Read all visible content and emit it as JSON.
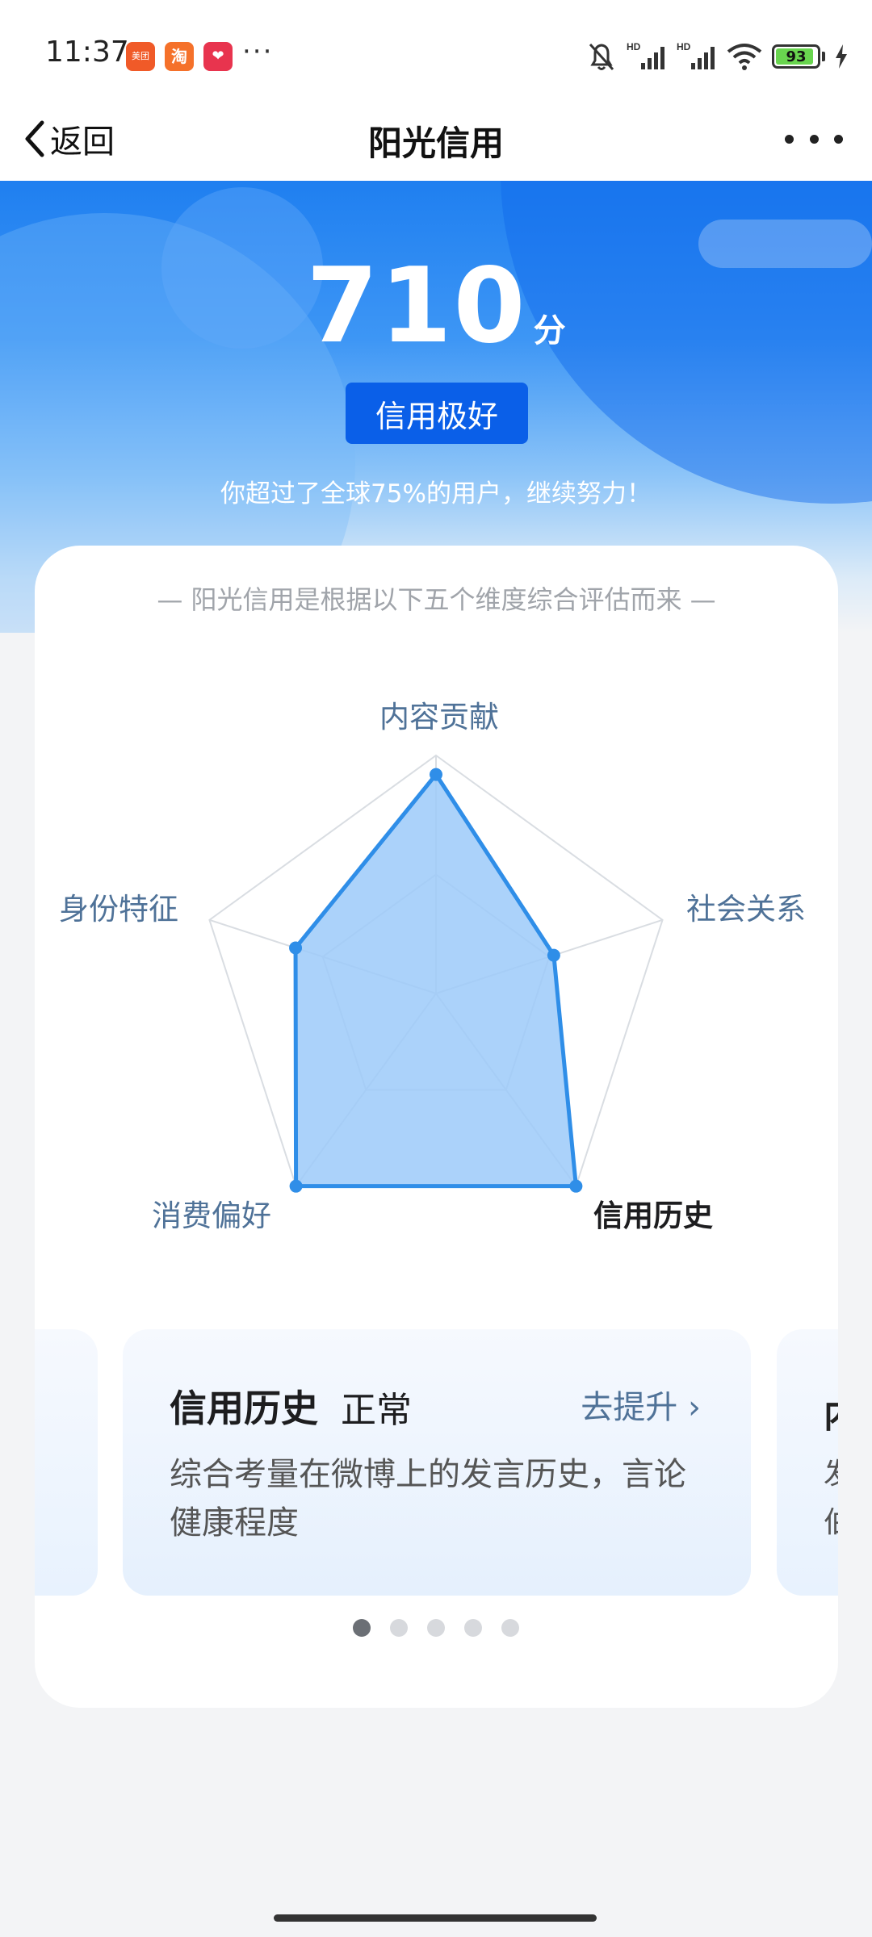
{
  "status_bar": {
    "time": "11:37",
    "apps": [
      {
        "name": "美团",
        "color": "#f05a28"
      },
      {
        "name": "淘",
        "color": "#f5712a"
      },
      {
        "name": "❤",
        "color": "#e8344e"
      }
    ],
    "more": "···",
    "battery": "93"
  },
  "nav": {
    "back_label": "返回",
    "title": "阳光信用"
  },
  "hero": {
    "score": "710",
    "score_unit": "分",
    "level": "信用极好",
    "rank_text": "你超过了全球75%的用户，继续努力！"
  },
  "card": {
    "subtitle": "— 阳光信用是根据以下五个维度综合评估而来 —"
  },
  "radar": {
    "dimensions": [
      {
        "label": "内容贡献",
        "value": 0.92
      },
      {
        "label": "社会关系",
        "value": 0.52
      },
      {
        "label": "信用历史",
        "value": 1.0
      },
      {
        "label": "消费偏好",
        "value": 1.0
      },
      {
        "label": "身份特征",
        "value": 0.62
      }
    ],
    "active_dimension": "信用历史"
  },
  "carousel": {
    "current": {
      "dimension": "信用历史",
      "status": "正常",
      "action": "去提升 ›",
      "description": "综合考量在微博上的发言历史，言论健康程度"
    },
    "next_peek": {
      "title": "内",
      "line1": "发",
      "line2": "伯"
    },
    "pages": 5,
    "active_page": 0
  },
  "colors": {
    "accent": "#0a5fe8",
    "radar_stroke": "#2f8ee8",
    "radar_fill": "#9ccaf9"
  }
}
